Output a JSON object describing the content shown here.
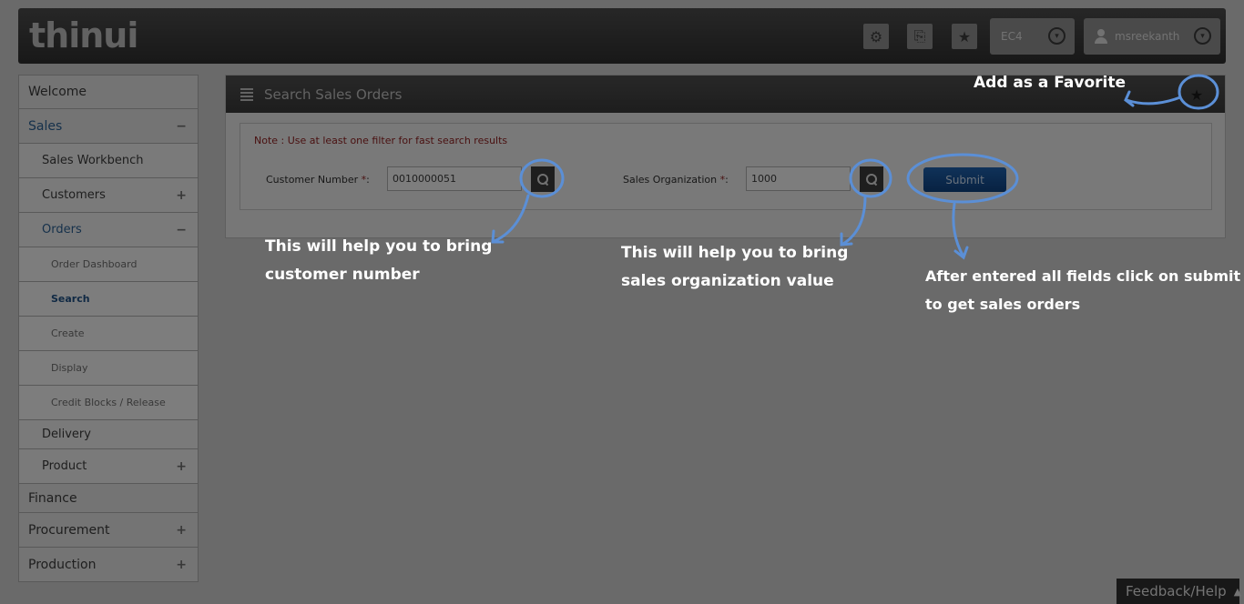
{
  "header": {
    "logo": "thinui",
    "icons": [
      "gear-icon",
      "export-icon",
      "star-icon"
    ],
    "system": "EC4",
    "user": "msreekanth"
  },
  "sidebar": {
    "items": [
      {
        "label": "Welcome"
      },
      {
        "label": "Sales",
        "sign": "−"
      },
      {
        "label": "Sales Workbench"
      },
      {
        "label": "Customers",
        "sign": "+"
      },
      {
        "label": "Orders",
        "sign": "−"
      },
      {
        "label": "Order Dashboard"
      },
      {
        "label": "Search"
      },
      {
        "label": "Create"
      },
      {
        "label": "Display"
      },
      {
        "label": "Credit Blocks / Release"
      },
      {
        "label": "Delivery"
      },
      {
        "label": "Product",
        "sign": "+"
      },
      {
        "label": "Finance"
      },
      {
        "label": "Procurement",
        "sign": "+"
      },
      {
        "label": "Production",
        "sign": "+"
      }
    ]
  },
  "panel": {
    "title": "Search Sales Orders",
    "note": "Note : Use at least one filter for fast search results",
    "customer_label": "Customer Number",
    "customer_value": "0010000051",
    "salesorg_label": "Sales Organization",
    "salesorg_value": "1000",
    "required_mark": "*",
    "colon": ":",
    "submit_label": "Submit"
  },
  "annotations": {
    "favorite": "Add as a Favorite",
    "customer_line1": "This will help    you to bring",
    "customer_line2": "customer number",
    "salesorg_line1": "This will help    you to bring",
    "salesorg_line2": "sales organization value",
    "submit_line1": "After entered all fields click on submit",
    "submit_line2": "to get sales orders",
    "color": "#5b8fd6"
  },
  "footer": {
    "feedback": "Feedback/Help"
  }
}
